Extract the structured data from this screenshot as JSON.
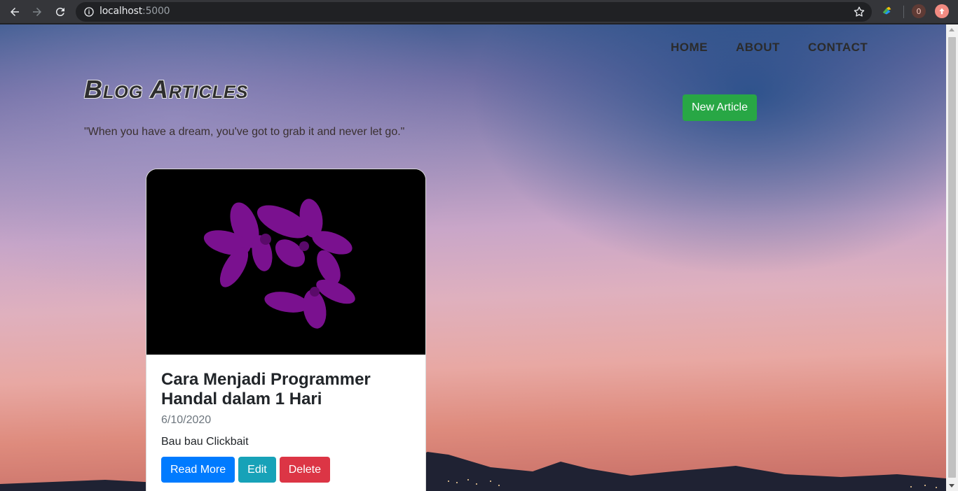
{
  "browser": {
    "url_host": "localhost",
    "url_port": ":5000",
    "extension_badge": "0"
  },
  "nav": {
    "home": "HOME",
    "about": "ABOUT",
    "contact": "CONTACT"
  },
  "header": {
    "title": "Blog Articles",
    "quote": "\"When you have a dream, you've got to grab it and never let go.\"",
    "new_article_label": "New Article"
  },
  "articles": [
    {
      "title": "Cara Menjadi Programmer Handal dalam 1 Hari",
      "date": "6/10/2020",
      "description": "Bau bau Clickbait",
      "read_more_label": "Read More",
      "edit_label": "Edit",
      "delete_label": "Delete"
    }
  ],
  "colors": {
    "success": "#28a745",
    "primary": "#007bff",
    "info": "#17a2b8",
    "danger": "#dc3545"
  }
}
